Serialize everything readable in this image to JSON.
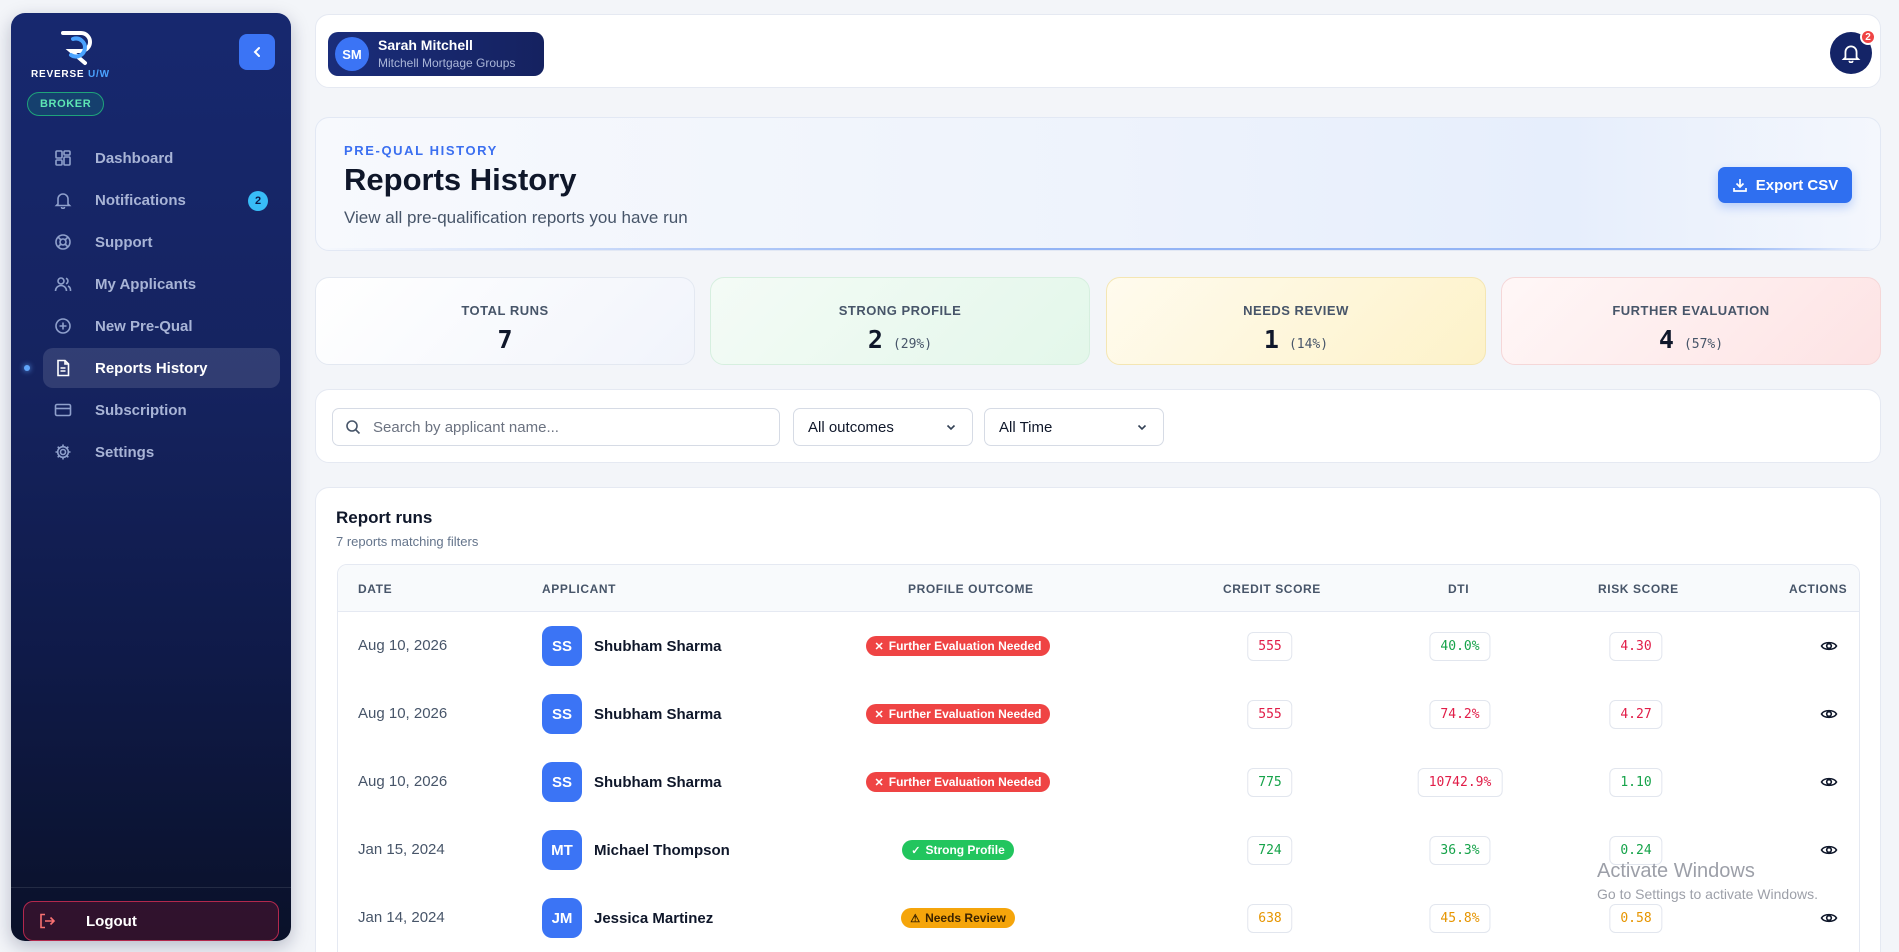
{
  "brand": {
    "name": "REVERSE",
    "suffix": "U/W"
  },
  "role_badge": "BROKER",
  "sidebar": {
    "items": [
      {
        "label": "Dashboard",
        "icon": "grid-icon"
      },
      {
        "label": "Notifications",
        "icon": "bell-icon",
        "badge": "2"
      },
      {
        "label": "Support",
        "icon": "lifebuoy-icon"
      },
      {
        "label": "My Applicants",
        "icon": "users-icon"
      },
      {
        "label": "New Pre-Qual",
        "icon": "plus-circle-icon"
      },
      {
        "label": "Reports History",
        "icon": "file-text-icon",
        "active": true
      },
      {
        "label": "Subscription",
        "icon": "credit-card-icon"
      },
      {
        "label": "Settings",
        "icon": "gear-icon"
      }
    ],
    "logout_label": "Logout"
  },
  "user": {
    "initials": "SM",
    "name": "Sarah Mitchell",
    "org": "Mitchell Mortgage Groups"
  },
  "notifications": {
    "count": "2"
  },
  "hero": {
    "eyebrow": "PRE-QUAL HISTORY",
    "title": "Reports History",
    "subtitle": "View all pre-qualification reports you have run",
    "export_label": "Export CSV"
  },
  "stats": {
    "total": {
      "label": "TOTAL RUNS",
      "value": "7"
    },
    "strong": {
      "label": "STRONG PROFILE",
      "value": "2",
      "pct": "(29%)"
    },
    "review": {
      "label": "NEEDS REVIEW",
      "value": "1",
      "pct": "(14%)"
    },
    "further": {
      "label": "FURTHER EVALUATION",
      "value": "4",
      "pct": "(57%)"
    }
  },
  "filters": {
    "search_placeholder": "Search by applicant name...",
    "outcome_selected": "All outcomes",
    "time_selected": "All Time"
  },
  "table": {
    "title": "Report runs",
    "subtitle": "7 reports matching filters",
    "columns": {
      "date": "DATE",
      "applicant": "APPLICANT",
      "outcome": "PROFILE OUTCOME",
      "credit": "CREDIT SCORE",
      "dti": "DTI",
      "risk": "RISK SCORE",
      "actions": "ACTIONS"
    },
    "rows": [
      {
        "date": "Aug 10, 2026",
        "initials": "SS",
        "name": "Shubham Sharma",
        "outcome": "Further Evaluation Needed",
        "outcome_type": "red",
        "credit": "555",
        "credit_tone": "red",
        "dti": "40.0%",
        "dti_tone": "green",
        "risk": "4.30",
        "risk_tone": "red"
      },
      {
        "date": "Aug 10, 2026",
        "initials": "SS",
        "name": "Shubham Sharma",
        "outcome": "Further Evaluation Needed",
        "outcome_type": "red",
        "credit": "555",
        "credit_tone": "red",
        "dti": "74.2%",
        "dti_tone": "red",
        "risk": "4.27",
        "risk_tone": "red"
      },
      {
        "date": "Aug 10, 2026",
        "initials": "SS",
        "name": "Shubham Sharma",
        "outcome": "Further Evaluation Needed",
        "outcome_type": "red",
        "credit": "775",
        "credit_tone": "green",
        "dti": "10742.9%",
        "dti_tone": "red",
        "risk": "1.10",
        "risk_tone": "green"
      },
      {
        "date": "Jan 15, 2024",
        "initials": "MT",
        "name": "Michael Thompson",
        "outcome": "Strong Profile",
        "outcome_type": "green",
        "credit": "724",
        "credit_tone": "green",
        "dti": "36.3%",
        "dti_tone": "green",
        "risk": "0.24",
        "risk_tone": "green"
      },
      {
        "date": "Jan 14, 2024",
        "initials": "JM",
        "name": "Jessica Martinez",
        "outcome": "Needs Review",
        "outcome_type": "amber",
        "credit": "638",
        "credit_tone": "amber",
        "dti": "45.8%",
        "dti_tone": "amber",
        "risk": "0.58",
        "risk_tone": "amber"
      }
    ]
  },
  "watermark": {
    "line1": "Activate Windows",
    "line2": "Go to Settings to activate Windows."
  },
  "colors": {
    "accent": "#3b74f5",
    "sidebar": "#15235f",
    "danger": "#ef4444",
    "success": "#22c55e",
    "warning": "#f5a50b"
  }
}
